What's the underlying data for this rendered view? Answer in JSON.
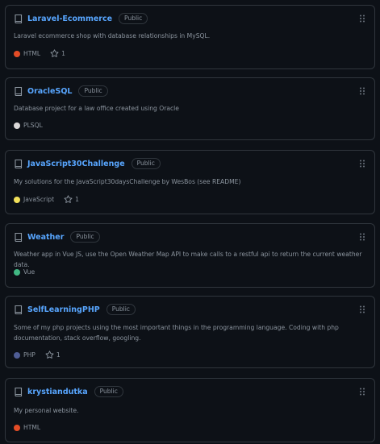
{
  "repositories": [
    {
      "name": "Laravel-Ecommerce",
      "visibility": "Public",
      "description": "Laravel ecommerce shop with database relationships in MySQL.",
      "language": "HTML",
      "language_color": "#e34c26",
      "stars": "1"
    },
    {
      "name": "OracleSQL",
      "visibility": "Public",
      "description": "Database project for a law office created using Oracle",
      "language": "PLSQL",
      "language_color": "#dad8d8",
      "stars": ""
    },
    {
      "name": "JavaScript30Challenge",
      "visibility": "Public",
      "description": "My solutions for the JavaScript30daysChallenge by WesBos (see README)",
      "language": "JavaScript",
      "language_color": "#f1e05a",
      "stars": "1"
    },
    {
      "name": "Weather",
      "visibility": "Public",
      "description": "Weather app in Vue JS, use the Open Weather Map API to make calls to a restful api to return the current weather data.",
      "language": "Vue",
      "language_color": "#41b883",
      "stars": ""
    },
    {
      "name": "SelfLearningPHP",
      "visibility": "Public",
      "description": "Some of my php projects using the most important things in the programming language. Coding with php documentation, stack overflow, googling.",
      "language": "PHP",
      "language_color": "#4f5d95",
      "stars": "1"
    },
    {
      "name": "krystiandutka",
      "visibility": "Public",
      "description": "My personal website.",
      "language": "HTML",
      "language_color": "#e34c26",
      "stars": ""
    }
  ],
  "icons": {
    "repo": "repo-icon",
    "star": "star-icon",
    "drag": "grip-icon"
  },
  "colors": {
    "link": "#58a6ff",
    "border": "#30363d",
    "muted": "#8b949e",
    "background": "#0d1117"
  }
}
